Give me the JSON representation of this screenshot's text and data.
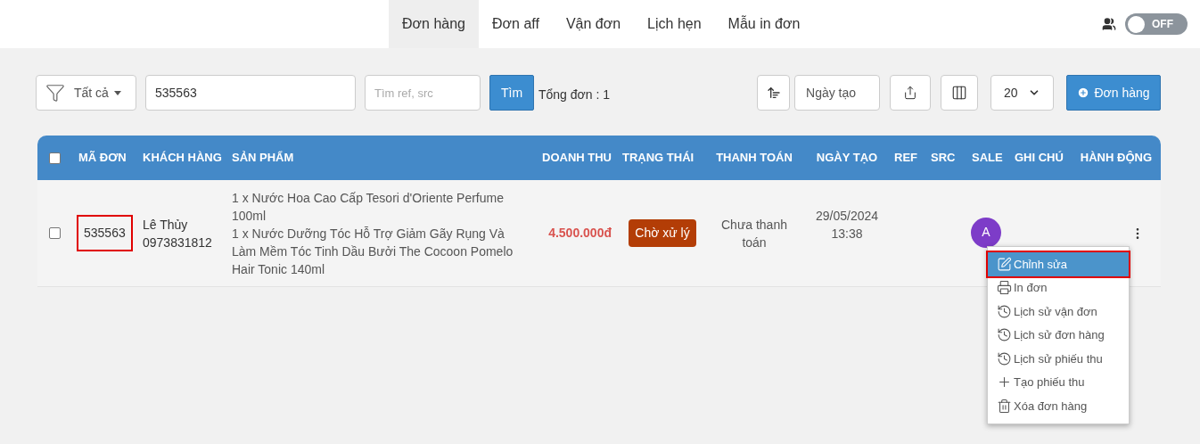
{
  "nav": {
    "tabs": [
      {
        "label": "Đơn hàng",
        "selected": true
      },
      {
        "label": "Đơn aff",
        "selected": false
      },
      {
        "label": "Vận đơn",
        "selected": false
      },
      {
        "label": "Lịch hẹn",
        "selected": false
      },
      {
        "label": "Mẫu in đơn",
        "selected": false
      }
    ],
    "toggle": {
      "label": "OFF",
      "on": false
    }
  },
  "toolbar": {
    "filter": "Tất cả",
    "search": "535563",
    "ref_placeholder": "Tìm ref, src",
    "search_button": "Tìm",
    "total": "Tổng đơn : 1",
    "sort_field": "Ngày tạo",
    "page_size": "20",
    "add_button": "Đơn hàng"
  },
  "table": {
    "columns": [
      "MÃ ĐƠN",
      "KHÁCH HÀNG",
      "SẢN PHẨM",
      "DOANH THU",
      "TRẠNG THÁI",
      "THANH TOÁN",
      "NGÀY TẠO",
      "REF",
      "SRC",
      "SALE",
      "GHI CHÚ",
      "HÀNH ĐỘNG"
    ],
    "header_checked": false,
    "rows": [
      {
        "checked": false,
        "id": "535563",
        "id_highlighted": true,
        "customer": "Lê Thủy",
        "phone": "0973831812",
        "products": [
          "1 x Nước Hoa Cao Cấp Tesori d'Oriente Perfume 100ml",
          "1 x Nước Dưỡng Tóc Hỗ Trợ Giảm Gãy Rụng Và Làm Mềm Tóc Tinh Dầu Bưởi The Cocoon Pomelo Hair Tonic 140ml"
        ],
        "revenue": "4.500.000đ",
        "status": {
          "label": "Chờ xử lý",
          "color": "#b33d06"
        },
        "payment": "Chưa thanh toán",
        "date": "29/05/2024",
        "time": "13:38",
        "sale_avatar": "A"
      }
    ]
  },
  "action_menu": {
    "items": [
      {
        "kind": "edit",
        "label": "Chỉnh sửa",
        "selected": true,
        "highlighted": true
      },
      {
        "kind": "print",
        "label": "In đơn",
        "selected": false,
        "highlighted": false
      },
      {
        "kind": "history",
        "label": "Lịch sử vận đơn",
        "selected": false,
        "highlighted": false
      },
      {
        "kind": "history",
        "label": "Lịch sử đơn hàng",
        "selected": false,
        "highlighted": false
      },
      {
        "kind": "history",
        "label": "Lịch sử phiếu thu",
        "selected": false,
        "highlighted": false
      },
      {
        "kind": "plus",
        "label": "Tạo phiếu thu",
        "selected": false,
        "highlighted": false
      },
      {
        "kind": "trash",
        "label": "Xóa đơn hàng",
        "selected": false,
        "highlighted": false
      }
    ]
  }
}
